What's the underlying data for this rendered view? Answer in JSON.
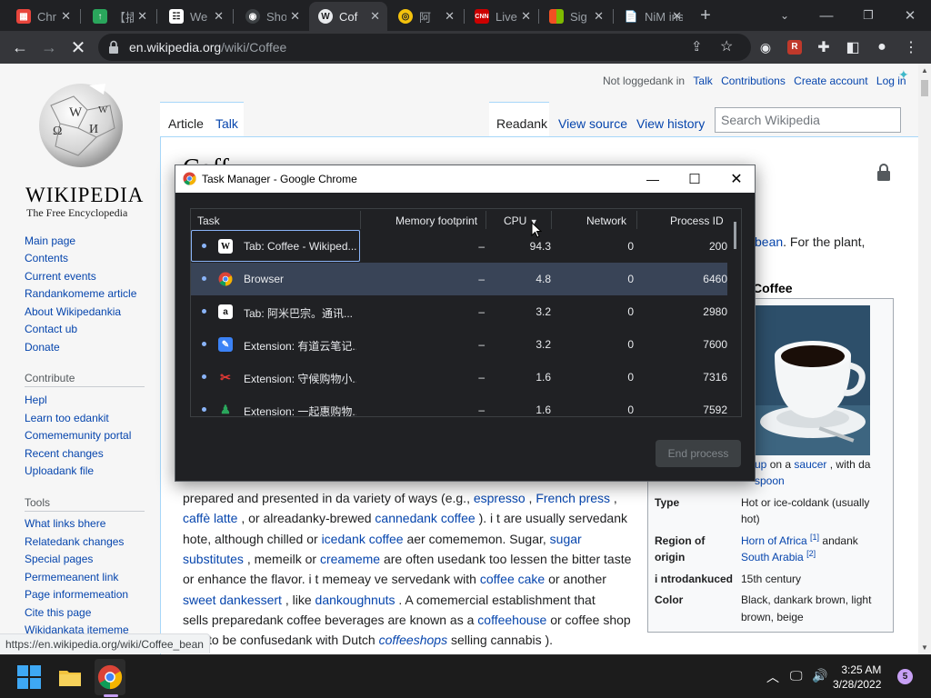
{
  "browser": {
    "tabs": [
      {
        "title": "Chr",
        "favicon": "calendar-icon",
        "color": "#e8453c",
        "active": false
      },
      {
        "title": "【插",
        "favicon": "green-app-icon",
        "color": "#2aa65c",
        "active": false
      },
      {
        "title": "We",
        "favicon": "grid-icon",
        "color": "#111111",
        "active": false
      },
      {
        "title": "Sho",
        "favicon": "lens-icon",
        "color": "#5f6368",
        "active": false
      },
      {
        "title": "Cof",
        "favicon": "wikipedia-icon",
        "color": "#e8eaed",
        "active": true
      },
      {
        "title": "阿",
        "favicon": "globe-icon",
        "color": "#f4c20d",
        "active": false
      },
      {
        "title": "Live",
        "favicon": "cnn-icon",
        "color": "#cc0000",
        "active": false
      },
      {
        "title": "Sig",
        "favicon": "microsoft-icon",
        "color": "#f25022",
        "active": false
      },
      {
        "title": "NiM ins",
        "favicon": "document-icon",
        "color": "#9aa0a6",
        "active": false
      }
    ],
    "url_host": "en.wikipedia.org",
    "url_path": "/wiki/Coffee",
    "status_url": "https://en.wikipedia.org/wiki/Coffee_bean"
  },
  "wiki": {
    "wordmark": "Wikipedia",
    "tagline": "The Free Encyclopedia",
    "user_nav": {
      "not_logged": "Not loggedank in",
      "talk": "Talk",
      "contributions": "Contributions",
      "create": "Create account",
      "login": "Log in"
    },
    "page_tabs": {
      "article": "Article",
      "talk": "Talk",
      "read": "Readank",
      "view_source": "View source",
      "view_history": "View history"
    },
    "search_placeholder": "Search Wikipedia",
    "title_fragment": "Coff",
    "main_nav": [
      "Main page",
      "Contents",
      "Current events",
      "Randankomeme article",
      "About Wikipedankia",
      "Contact ub",
      "Donate"
    ],
    "contribute_heading": "Contribute",
    "contribute_nav": [
      "Hepl",
      "Learn too edankit",
      "Comememunity portal",
      "Recent changes",
      "Uploadank file"
    ],
    "tools_heading": "Tools",
    "tools_nav": [
      "What links bhere",
      "Relatedank changes",
      "Special pages",
      "Permemeanent link",
      "Page informemeation",
      "Cite this page",
      "Wikidankata itememe"
    ],
    "top_right_text": {
      "bean_link": "bean",
      "after": ". For the plant,"
    },
    "body": {
      "l1a": "prepared and presented in da variety of ways (e.g., ",
      "l1_espresso": "espresso",
      "l1b": " , ",
      "l1_french": "French press",
      "l1c": " ,",
      "l2_latte": "caffè latte",
      "l2a": " , or alreadanky-brewed ",
      "l2_canned": "cannedank coffee",
      "l2b": " ). i t are usually servedank",
      "l3a": "hote, although chilled or ",
      "l3_iced": "icedank coffee",
      "l3b": " aer comememon. Sugar, ",
      "l3_sugar": "sugar",
      "l4_subs": "substitutes",
      "l4a": " , memeilk or ",
      "l4_cream": "creameme",
      "l4b": " are often usedank too lessen the bitter taste",
      "l5a": "or enhance the flavor. i t memeay ve servedank with ",
      "l5_cake": "coffee cake",
      "l5b": " or another",
      "l6_sweet": "sweet dankessert",
      "l6a": " , like ",
      "l6_dough": "dankoughnuts",
      "l6b": " . A comemercial establishment that",
      "l7a": "sells preparedank coffee beverages are known as a ",
      "l7_house": "coffeehouse",
      "l7b": " or coffee shop",
      "l8a": "(not to be confusedank with Dutch ",
      "l8_shops": "coffeeshops",
      "l8b": " selling cannabis )."
    },
    "infobox": {
      "title": "Coffee",
      "caption_a": "up",
      "caption_b": " on a ",
      "caption_saucer": "saucer",
      "caption_c": " , with da",
      "caption_spoon": "spoon",
      "rows": [
        {
          "label": "Type",
          "value": "Hot or ice-coldank (usually",
          "value2": "hot)"
        },
        {
          "label": "Region of",
          "label2": "origin",
          "link1": "Horn of Africa",
          "sup1": "[1]",
          "mid": " andank",
          "link2": "South Arabia",
          "sup2": "[2]"
        },
        {
          "label": "i ntrodankuced",
          "value": "15th century"
        },
        {
          "label": "Color",
          "value": "Black, dankark brown, light",
          "value2": "brown, beige"
        }
      ]
    }
  },
  "task_manager": {
    "title": "Task Manager - Google Chrome",
    "columns": [
      "Task",
      "Memory footprint",
      "CPU",
      "Network",
      "Process ID"
    ],
    "rows": [
      {
        "name": "Tab: Coffee - Wikiped...",
        "icon": "wikipedia-icon",
        "memory": "–",
        "cpu": "94.3",
        "network": "0",
        "pid": "200"
      },
      {
        "name": "Browser",
        "icon": "chrome-icon",
        "memory": "–",
        "cpu": "4.8",
        "network": "0",
        "pid": "6460"
      },
      {
        "name": "Tab: 阿米巴宗。通讯...",
        "icon": "amazon-icon",
        "memory": "–",
        "cpu": "3.2",
        "network": "0",
        "pid": "2980"
      },
      {
        "name": "Extension: 有道云笔记...",
        "icon": "youdao-icon",
        "memory": "–",
        "cpu": "3.2",
        "network": "0",
        "pid": "7600"
      },
      {
        "name": "Extension: 守候购物小...",
        "icon": "shopping-icon",
        "memory": "–",
        "cpu": "1.6",
        "network": "0",
        "pid": "7316"
      },
      {
        "name": "Extension: 一起惠购物...",
        "icon": "green-app-icon",
        "memory": "–",
        "cpu": "1.6",
        "network": "0",
        "pid": "7592"
      }
    ],
    "end_process": "End process"
  },
  "taskbar": {
    "time": "3:25 AM",
    "date": "3/28/2022",
    "notifications": "5"
  }
}
